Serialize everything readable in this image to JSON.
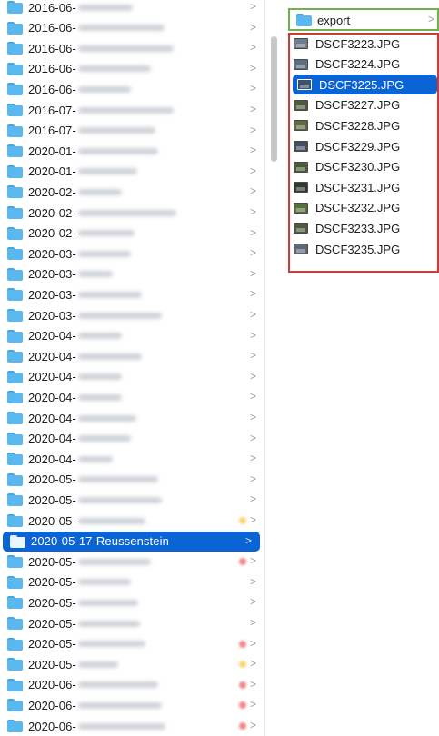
{
  "left_column": {
    "items": [
      {
        "label": "2016-06-",
        "chevron": ">",
        "tag": ""
      },
      {
        "label": "2016-06-",
        "chevron": ">",
        "tag": ""
      },
      {
        "label": "2016-06-",
        "chevron": ">",
        "tag": ""
      },
      {
        "label": "2016-06-",
        "chevron": ">",
        "tag": ""
      },
      {
        "label": "2016-06-",
        "chevron": ">",
        "tag": ""
      },
      {
        "label": "2016-07-",
        "chevron": ">",
        "tag": ""
      },
      {
        "label": "2016-07-",
        "chevron": ">",
        "tag": ""
      },
      {
        "label": "2020-01-",
        "chevron": ">",
        "tag": ""
      },
      {
        "label": "2020-01-",
        "chevron": ">",
        "tag": ""
      },
      {
        "label": "2020-02-",
        "chevron": ">",
        "tag": ""
      },
      {
        "label": "2020-02-",
        "chevron": ">",
        "tag": ""
      },
      {
        "label": "2020-02-",
        "chevron": ">",
        "tag": ""
      },
      {
        "label": "2020-03-",
        "chevron": ">",
        "tag": ""
      },
      {
        "label": "2020-03-",
        "chevron": ">",
        "tag": ""
      },
      {
        "label": "2020-03-",
        "chevron": ">",
        "tag": ""
      },
      {
        "label": "2020-03-",
        "chevron": ">",
        "tag": ""
      },
      {
        "label": "2020-04-",
        "chevron": ">",
        "tag": ""
      },
      {
        "label": "2020-04-",
        "chevron": ">",
        "tag": ""
      },
      {
        "label": "2020-04-",
        "chevron": ">",
        "tag": ""
      },
      {
        "label": "2020-04-",
        "chevron": ">",
        "tag": ""
      },
      {
        "label": "2020-04-",
        "chevron": ">",
        "tag": ""
      },
      {
        "label": "2020-04-",
        "chevron": ">",
        "tag": ""
      },
      {
        "label": "2020-04-",
        "chevron": ">",
        "tag": ""
      },
      {
        "label": "2020-05-",
        "chevron": ">",
        "tag": ""
      },
      {
        "label": "2020-05-",
        "chevron": ">",
        "tag": ""
      },
      {
        "label": "2020-05-",
        "chevron": ">",
        "tag": "yellow"
      },
      {
        "label": "2020-05-17-Reussenstein",
        "chevron": ">",
        "tag": "",
        "selected": true
      },
      {
        "label": "2020-05-",
        "chevron": ">",
        "tag": "red"
      },
      {
        "label": "2020-05-",
        "chevron": ">",
        "tag": ""
      },
      {
        "label": "2020-05-",
        "chevron": ">",
        "tag": ""
      },
      {
        "label": "2020-05-",
        "chevron": ">",
        "tag": ""
      },
      {
        "label": "2020-05-",
        "chevron": ">",
        "tag": "red"
      },
      {
        "label": "2020-05-",
        "chevron": ">",
        "tag": "yellow"
      },
      {
        "label": "2020-06-",
        "chevron": ">",
        "tag": "red"
      },
      {
        "label": "2020-06-",
        "chevron": ">",
        "tag": "red"
      },
      {
        "label": "2020-06-",
        "chevron": ">",
        "tag": "red"
      }
    ]
  },
  "right_column": {
    "folder": {
      "label": "export",
      "chevron": ">"
    },
    "files": [
      {
        "name": "DSCF3223.JPG",
        "thumb": "#6b7d8f"
      },
      {
        "name": "DSCF3224.JPG",
        "thumb": "#5c6f82"
      },
      {
        "name": "DSCF3225.JPG",
        "thumb": "#3d5266",
        "selected": true
      },
      {
        "name": "DSCF3227.JPG",
        "thumb": "#4e5a3c"
      },
      {
        "name": "DSCF3228.JPG",
        "thumb": "#5a6b44"
      },
      {
        "name": "DSCF3229.JPG",
        "thumb": "#3f4f60"
      },
      {
        "name": "DSCF3230.JPG",
        "thumb": "#485c3a"
      },
      {
        "name": "DSCF3231.JPG",
        "thumb": "#2f3a30"
      },
      {
        "name": "DSCF3232.JPG",
        "thumb": "#55703b"
      },
      {
        "name": "DSCF3233.JPG",
        "thumb": "#4c5a3e"
      },
      {
        "name": "DSCF3235.JPG",
        "thumb": "#5a6878"
      }
    ]
  },
  "colors": {
    "selection": "#0a64d6",
    "folder": "#5bb8ee",
    "export_outline": "#72b04e",
    "files_outline": "#d23a3a"
  }
}
